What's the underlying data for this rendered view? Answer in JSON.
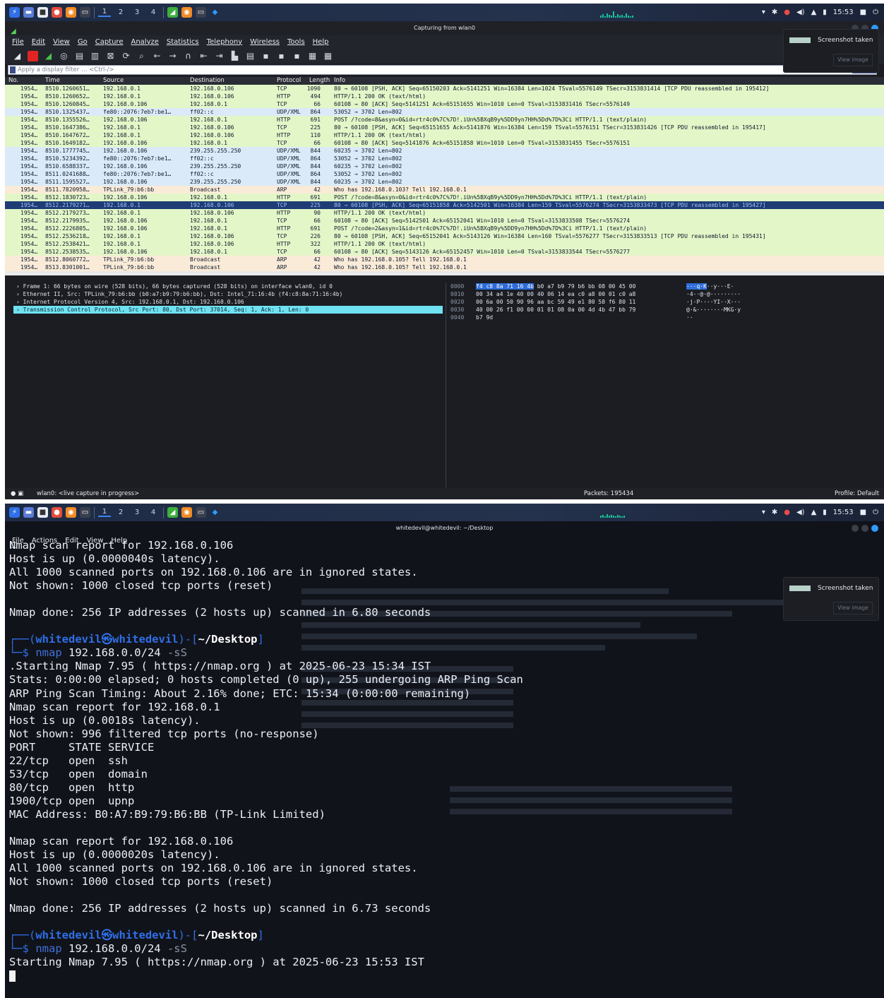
{
  "panel": {
    "workspaces": [
      "1",
      "2",
      "3",
      "4"
    ],
    "clock": "15:53"
  },
  "wireshark": {
    "title": "Capturing from wlan0",
    "menu": [
      "File",
      "Edit",
      "View",
      "Go",
      "Capture",
      "Analyze",
      "Statistics",
      "Telephony",
      "Wireless",
      "Tools",
      "Help"
    ],
    "filter_placeholder": "Apply a display filter … <Ctrl-/>",
    "columns": {
      "no": "No.",
      "time": "Time",
      "source": "Source",
      "destination": "Destination",
      "protocol": "Protocol",
      "length": "Length",
      "info": "Info"
    },
    "packets": [
      {
        "no": "1954…",
        "time": "8510.1260651…",
        "src": "192.168.0.1",
        "dst": "192.168.0.106",
        "proto": "TCP",
        "len": "1090",
        "info": "80 → 60108 [PSH, ACK] Seq=65150203 Ack=5141251 Win=16384 Len=1024 TSval=5576149 TSecr=3153831414 [TCP PDU reassembled in 195412]",
        "cls": "tcp"
      },
      {
        "no": "1954…",
        "time": "8510.1260652…",
        "src": "192.168.0.1",
        "dst": "192.168.0.106",
        "proto": "HTTP",
        "len": "494",
        "info": "HTTP/1.1 200 OK  (text/html)",
        "cls": "tcp"
      },
      {
        "no": "1954…",
        "time": "8510.1260845…",
        "src": "192.168.0.106",
        "dst": "192.168.0.1",
        "proto": "TCP",
        "len": "66",
        "info": "60108 → 80 [ACK] Seq=5141251 Ack=65151655 Win=1010 Len=0 TSval=3153831416 TSecr=5576149",
        "cls": "tcp"
      },
      {
        "no": "1954…",
        "time": "8510.1325437…",
        "src": "fe80::2076:7eb7:be1…",
        "dst": "ff02::c",
        "proto": "UDP/XML",
        "len": "864",
        "info": "53052 → 3702 Len=802",
        "cls": "udp"
      },
      {
        "no": "1954…",
        "time": "8510.1355526…",
        "src": "192.168.0.106",
        "dst": "192.168.0.1",
        "proto": "HTTP",
        "len": "691",
        "info": "POST /?code=8&asyn=0&id=rtr4c0%7C%7D!.iUn%5BXqB9y%5DD9yn7HH%5Dd%7D%3Ci HTTP/1.1  (text/plain)",
        "cls": "tcp"
      },
      {
        "no": "1954…",
        "time": "8510.1647386…",
        "src": "192.168.0.1",
        "dst": "192.168.0.106",
        "proto": "TCP",
        "len": "225",
        "info": "80 → 60108 [PSH, ACK] Seq=65151655 Ack=5141876 Win=16384 Len=159 TSval=5576151 TSecr=3153831426 [TCP PDU reassembled in 195417]",
        "cls": "tcp"
      },
      {
        "no": "1954…",
        "time": "8510.1647672…",
        "src": "192.168.0.1",
        "dst": "192.168.0.106",
        "proto": "HTTP",
        "len": "110",
        "info": "HTTP/1.1 200 OK  (text/html)",
        "cls": "tcp"
      },
      {
        "no": "1954…",
        "time": "8510.1649182…",
        "src": "192.168.0.106",
        "dst": "192.168.0.1",
        "proto": "TCP",
        "len": "66",
        "info": "60108 → 80 [ACK] Seq=5141876 Ack=65151858 Win=1010 Len=0 TSval=3153831455 TSecr=5576151",
        "cls": "tcp"
      },
      {
        "no": "1954…",
        "time": "8510.1777745…",
        "src": "192.168.0.106",
        "dst": "239.255.255.250",
        "proto": "UDP/XML",
        "len": "844",
        "info": "60235 → 3702 Len=802",
        "cls": "udp"
      },
      {
        "no": "1954…",
        "time": "8510.5234392…",
        "src": "fe80::2076:7eb7:be1…",
        "dst": "ff02::c",
        "proto": "UDP/XML",
        "len": "864",
        "info": "53052 → 3702 Len=802",
        "cls": "udp"
      },
      {
        "no": "1954…",
        "time": "8510.6588337…",
        "src": "192.168.0.106",
        "dst": "239.255.255.250",
        "proto": "UDP/XML",
        "len": "844",
        "info": "60235 → 3702 Len=802",
        "cls": "udp"
      },
      {
        "no": "1954…",
        "time": "8511.0241688…",
        "src": "fe80::2076:7eb7:be1…",
        "dst": "ff02::c",
        "proto": "UDP/XML",
        "len": "864",
        "info": "53052 → 3702 Len=802",
        "cls": "udp"
      },
      {
        "no": "1954…",
        "time": "8511.1595527…",
        "src": "192.168.0.106",
        "dst": "239.255.255.250",
        "proto": "UDP/XML",
        "len": "844",
        "info": "60235 → 3702 Len=802",
        "cls": "udp"
      },
      {
        "no": "1954…",
        "time": "8511.7820958…",
        "src": "TPLink_79:b6:bb",
        "dst": "Broadcast",
        "proto": "ARP",
        "len": "42",
        "info": "Who has 192.168.0.103? Tell 192.168.0.1",
        "cls": "arp"
      },
      {
        "no": "1954…",
        "time": "8512.1830723…",
        "src": "192.168.0.106",
        "dst": "192.168.0.1",
        "proto": "HTTP",
        "len": "691",
        "info": "POST /?code=8&asyn=0&id=rtr4c0%7C%7D!.iUn%5BXqB9y%5DD9yn7HH%5Dd%7D%3Ci HTTP/1.1  (text/plain)",
        "cls": "tcp"
      },
      {
        "no": "1954…",
        "time": "8512.2179271…",
        "src": "192.168.0.1",
        "dst": "192.168.0.106",
        "proto": "TCP",
        "len": "225",
        "info": "80 → 60108 [PSH, ACK] Seq=65151858 Ack=5142501 Win=16384 Len=159 TSval=5576274 TSecr=3153833473 [TCP PDU reassembled in 195427]",
        "cls": "sel"
      },
      {
        "no": "1954…",
        "time": "8512.2179273…",
        "src": "192.168.0.1",
        "dst": "192.168.0.106",
        "proto": "HTTP",
        "len": "90",
        "info": "HTTP/1.1 200 OK  (text/html)",
        "cls": "tcp"
      },
      {
        "no": "1954…",
        "time": "8512.2179935…",
        "src": "192.168.0.106",
        "dst": "192.168.0.1",
        "proto": "TCP",
        "len": "66",
        "info": "60108 → 80 [ACK] Seq=5142501 Ack=65152041 Win=1010 Len=0 TSval=3153833508 TSecr=5576274",
        "cls": "tcp"
      },
      {
        "no": "1954…",
        "time": "8512.2226805…",
        "src": "192.168.0.106",
        "dst": "192.168.0.1",
        "proto": "HTTP",
        "len": "691",
        "info": "POST /?code=2&asyn=1&id=rtr4c0%7C%7D!.iUn%5BXqB9y%5DD9yn7HH%5Dd%7D%3Ci HTTP/1.1  (text/plain)",
        "cls": "tcp"
      },
      {
        "no": "1954…",
        "time": "8512.2536218…",
        "src": "192.168.0.1",
        "dst": "192.168.0.106",
        "proto": "TCP",
        "len": "226",
        "info": "80 → 60108 [PSH, ACK] Seq=65152041 Ack=5143126 Win=16384 Len=160 TSval=5576277 TSecr=3153833513 [TCP PDU reassembled in 195431]",
        "cls": "tcp"
      },
      {
        "no": "1954…",
        "time": "8512.2538421…",
        "src": "192.168.0.1",
        "dst": "192.168.0.106",
        "proto": "HTTP",
        "len": "322",
        "info": "HTTP/1.1 200 OK  (text/html)",
        "cls": "tcp"
      },
      {
        "no": "1954…",
        "time": "8512.2538535…",
        "src": "192.168.0.106",
        "dst": "192.168.0.1",
        "proto": "TCP",
        "len": "66",
        "info": "60108 → 80 [ACK] Seq=5143126 Ack=65152457 Win=1010 Len=0 TSval=3153833544 TSecr=5576277",
        "cls": "tcp"
      },
      {
        "no": "1954…",
        "time": "8512.8060772…",
        "src": "TPLink_79:b6:bb",
        "dst": "Broadcast",
        "proto": "ARP",
        "len": "42",
        "info": "Who has 192.168.0.105? Tell 192.168.0.1",
        "cls": "arp"
      },
      {
        "no": "1954…",
        "time": "8513.8301001…",
        "src": "TPLink_79:b6:bb",
        "dst": "Broadcast",
        "proto": "ARP",
        "len": "42",
        "info": "Who has 192.168.0.105? Tell 192.168.0.1",
        "cls": "arp"
      }
    ],
    "details": [
      "› Frame 1: 66 bytes on wire (528 bits), 66 bytes captured (528 bits) on interface wlan0, id 0",
      "› Ethernet II, Src: TPLink_79:b6:bb (b0:a7:b9:79:b6:bb), Dst: Intel_71:16:4b (f4:c8:8a:71:16:4b)",
      "› Internet Protocol Version 4, Src: 192.168.0.1, Dst: 192.168.0.106",
      "› Transmission Control Protocol, Src Port: 80, Dst Port: 37014, Seq: 1, Ack: 1, Len: 0"
    ],
    "hex": [
      {
        "off": "0000",
        "bytes_hl": "f4 c8 8a 71 16 4b",
        "bytes": " b0 a7  b9 79 b6 bb 08 00 45 00",
        "ascii_hl": "···q·K",
        "ascii": "··y···E·"
      },
      {
        "off": "0010",
        "bytes_hl": "",
        "bytes": "00 34 a4 1e 40 00 40 06  14 ea c0 a8 00 01 c0 a8",
        "ascii_hl": "",
        "ascii": "·4··@·@·········"
      },
      {
        "off": "0020",
        "bytes_hl": "",
        "bytes": "00 6a 00 50 90 96 aa bc  59 49 e1 80 58 f6 80 11",
        "ascii_hl": "",
        "ascii": "·j·P····YI··X···"
      },
      {
        "off": "0030",
        "bytes_hl": "",
        "bytes": "40 00 26 f1 00 00 01 01  08 0a 00 4d 4b 47 bb 79",
        "ascii_hl": "",
        "ascii": "@·&········MKG·y"
      },
      {
        "off": "0040",
        "bytes_hl": "",
        "bytes": "b7 9d",
        "ascii_hl": "",
        "ascii": "··"
      }
    ],
    "status": {
      "capture": "wlan0: <live capture in progress>",
      "packets": "Packets: 195434",
      "profile": "Profile: Default"
    }
  },
  "toast": {
    "title": "Screenshot taken",
    "button": "View image"
  },
  "terminal": {
    "title": "whitedevil@whitedevil: ~/Desktop",
    "menu": [
      "File",
      "Actions",
      "Edit",
      "View",
      "Help"
    ],
    "user": "whitedevil",
    "host": "whitedevil",
    "cwd": "~/Desktop",
    "lines_a": [
      "Nmap scan report for 192.168.0.106",
      "Host is up (0.0000040s latency).",
      "All 1000 scanned ports on 192.168.0.106 are in ignored states.",
      "Not shown: 1000 closed tcp ports (reset)",
      "",
      "Nmap done: 256 IP addresses (2 hosts up) scanned in 6.80 seconds",
      ""
    ],
    "cmd1": "nmap",
    "args1": " 192.168.0.0/24 ",
    "flag1": "-sS",
    "lines_b": [
      ".Starting Nmap 7.95 ( https://nmap.org ) at 2025-06-23 15:34 IST",
      "Stats: 0:00:00 elapsed; 0 hosts completed (0 up), 255 undergoing ARP Ping Scan",
      "ARP Ping Scan Timing: About 2.16% done; ETC: 15:34 (0:00:00 remaining)",
      "Nmap scan report for 192.168.0.1",
      "Host is up (0.0018s latency).",
      "Not shown: 996 filtered tcp ports (no-response)",
      "PORT     STATE SERVICE",
      "22/tcp   open  ssh",
      "53/tcp   open  domain",
      "80/tcp   open  http",
      "1900/tcp open  upnp",
      "MAC Address: B0:A7:B9:79:B6:BB (TP-Link Limited)",
      "",
      "Nmap scan report for 192.168.0.106",
      "Host is up (0.0000020s latency).",
      "All 1000 scanned ports on 192.168.0.106 are in ignored states.",
      "Not shown: 1000 closed tcp ports (reset)",
      "",
      "Nmap done: 256 IP addresses (2 hosts up) scanned in 6.73 seconds",
      ""
    ],
    "cmd2": "nmap",
    "args2": " 192.168.0.0/24 ",
    "flag2": "-sS",
    "lines_c": [
      "Starting Nmap 7.95 ( https://nmap.org ) at 2025-06-23 15:53 IST"
    ]
  },
  "colors": {
    "accent": "#2f6fe8",
    "selected_row": "#1f3c74",
    "tcp_row": "#e3f6c8",
    "udp_row": "#daeaf8",
    "arp_row": "#f9ebd8"
  }
}
